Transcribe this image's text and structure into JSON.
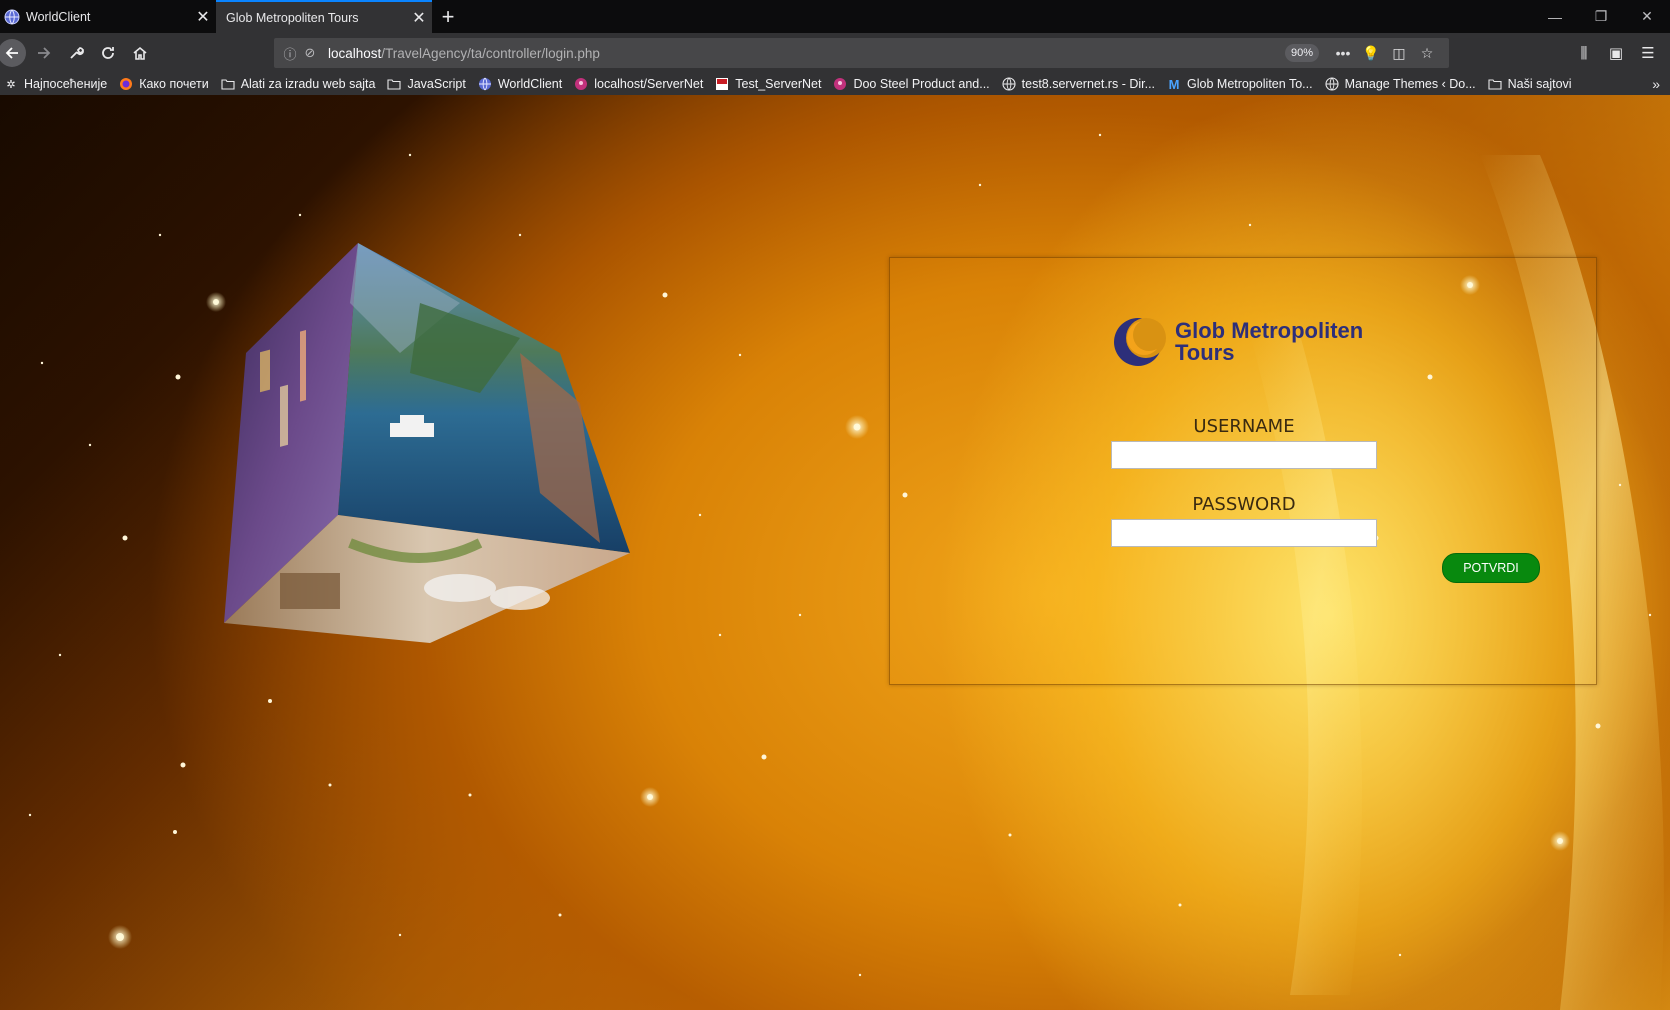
{
  "browser": {
    "tabs": [
      {
        "title": "WorldClient",
        "active": false
      },
      {
        "title": "Glob Metropoliten Tours",
        "active": true
      }
    ],
    "url_host": "localhost",
    "url_path": "/TravelAgency/ta/controller/login.php",
    "zoom": "90%",
    "bookmarks": [
      {
        "label": "Најпосећеније",
        "icon": "gear-icon"
      },
      {
        "label": "Како почети",
        "icon": "firefox-icon"
      },
      {
        "label": "Alati za izradu web sajta",
        "icon": "folder-icon"
      },
      {
        "label": "JavaScript",
        "icon": "folder-icon"
      },
      {
        "label": "WorldClient",
        "icon": "globe-icon"
      },
      {
        "label": "localhost/ServerNet",
        "icon": "servernet-icon"
      },
      {
        "label": "Test_ServerNet",
        "icon": "servernet-red-icon"
      },
      {
        "label": "Doo Steel Product and...",
        "icon": "servernet-icon"
      },
      {
        "label": "test8.servernet.rs - Dir...",
        "icon": "globe-icon"
      },
      {
        "label": "Glob Metropoliten To...",
        "icon": "m-logo-icon"
      },
      {
        "label": "Manage Themes ‹ Do...",
        "icon": "globe-icon"
      },
      {
        "label": "Naši sajtovi",
        "icon": "folder-icon"
      }
    ]
  },
  "login": {
    "logo_line1": "Glob Metropoliten",
    "logo_line2": "Tours",
    "username_label": "USERNAME",
    "password_label": "PASSWORD",
    "submit_label": "POTVRDI"
  },
  "colors": {
    "tab_accent": "#0a84ff",
    "button_green": "#08890e",
    "logo_navy": "#2d2f7a",
    "logo_orange": "#f4a31a"
  }
}
